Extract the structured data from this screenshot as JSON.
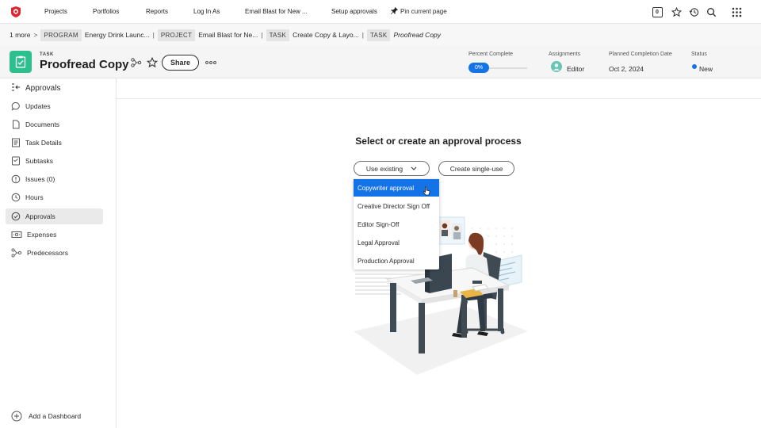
{
  "topnav": {
    "items": [
      "Projects",
      "Portfolios",
      "Reports",
      "Log In As",
      "Email Blast for New ...",
      "Setup approvals"
    ],
    "pin_label": "Pin current page",
    "badge_count": "0"
  },
  "breadcrumb": {
    "more": "1 more",
    "program_badge": "PROGRAM",
    "program_name": "Energy Drink Launc...",
    "project_badge": "PROJECT",
    "project_name": "Email Blast for Ne...",
    "task_badge_1": "TASK",
    "task_name_1": "Create Copy & Layo...",
    "task_badge_2": "TASK",
    "task_name_2": "Proofread Copy"
  },
  "header": {
    "object_type": "TASK",
    "title": "Proofread Copy",
    "share_label": "Share",
    "percent_complete_label": "Percent Complete",
    "percent_complete_value": "0%",
    "assignments_label": "Assignments",
    "assignments_value": "Editor",
    "planned_completion_label": "Planned Completion Date",
    "planned_completion_value": "Oct 2, 2024",
    "status_label": "Status",
    "status_value": "New",
    "accent_color": "#1473e6",
    "task_icon_color": "#2dbf8e"
  },
  "sidebar": {
    "section_title": "Approvals",
    "items": [
      {
        "label": "Updates",
        "icon": "speech-bubble-icon"
      },
      {
        "label": "Documents",
        "icon": "document-icon"
      },
      {
        "label": "Task Details",
        "icon": "details-icon"
      },
      {
        "label": "Subtasks",
        "icon": "subtasks-icon"
      },
      {
        "label": "Issues (0)",
        "icon": "issue-icon"
      },
      {
        "label": "Hours",
        "icon": "clock-icon"
      },
      {
        "label": "Approvals",
        "icon": "check-circle-icon"
      },
      {
        "label": "Expenses",
        "icon": "expenses-icon"
      },
      {
        "label": "Predecessors",
        "icon": "predecessors-icon"
      }
    ],
    "active_item": "Approvals",
    "add_dashboard_label": "Add a Dashboard"
  },
  "main": {
    "title": "Select or create an approval process",
    "use_existing_label": "Use existing",
    "create_single_use_label": "Create single-use",
    "dropdown_options": [
      "Copywriter approval",
      "Creative Director Sign Off",
      "Editor Sign-Off",
      "Legal Approval",
      "Production Approval"
    ],
    "highlighted_option": "Copywriter approval"
  }
}
